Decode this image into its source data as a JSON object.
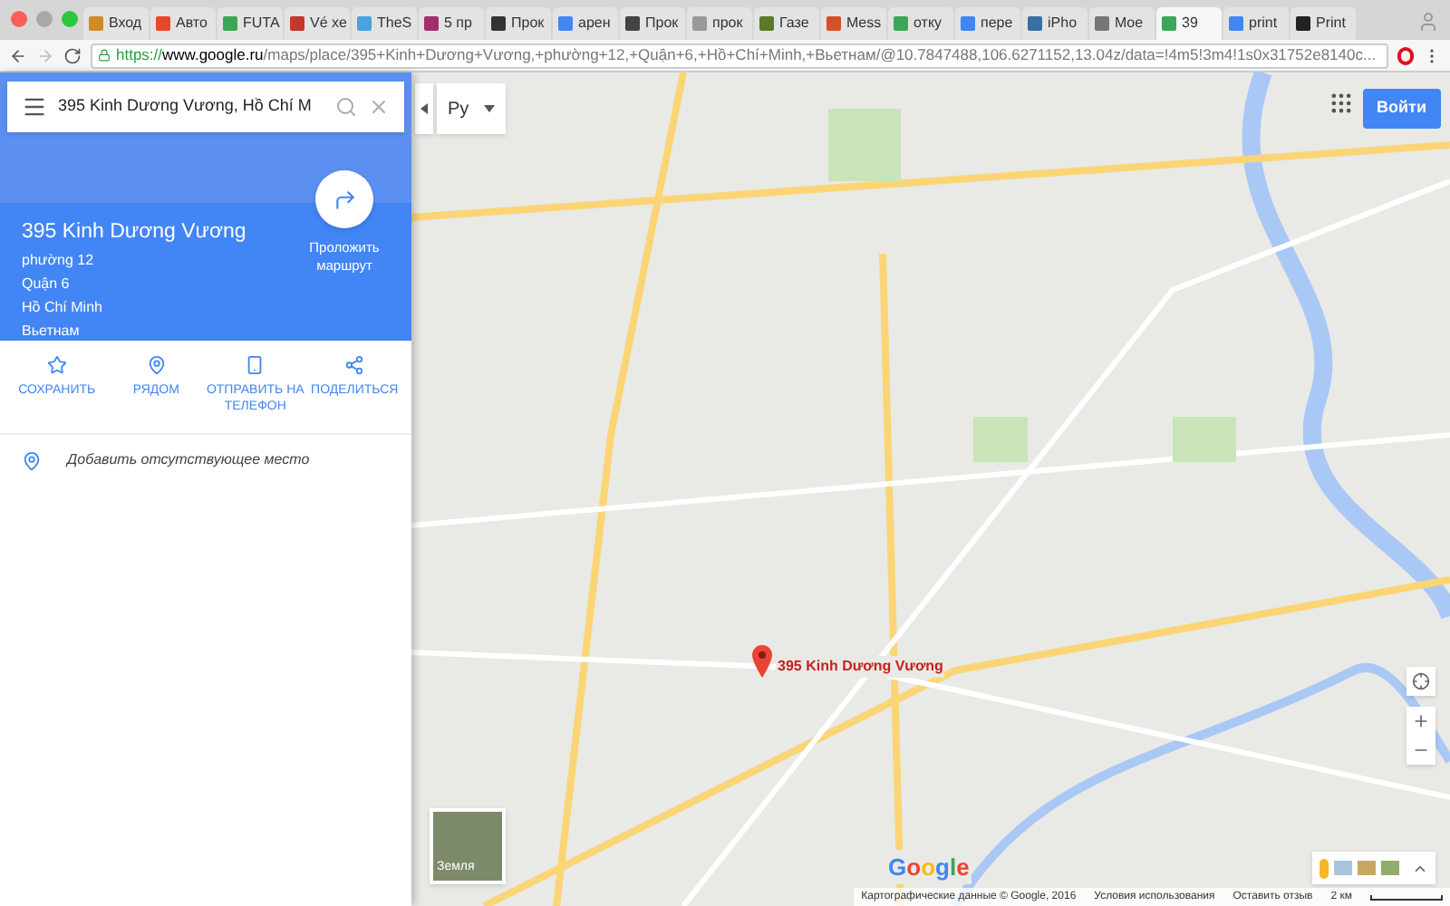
{
  "tabs": [
    {
      "title": "Вход",
      "color": "#d08a2a",
      "selected": false
    },
    {
      "title": "Авто",
      "color": "#e8452c",
      "selected": false
    },
    {
      "title": "FUTA",
      "color": "#3aa757",
      "selected": false
    },
    {
      "title": "Vé xe",
      "color": "#c0392b",
      "selected": false
    },
    {
      "title": "TheS",
      "color": "#4aa3df",
      "selected": false
    },
    {
      "title": "5 пр",
      "color": "#a0306a",
      "selected": false
    },
    {
      "title": "Прок",
      "color": "#333333",
      "selected": false
    },
    {
      "title": "арен",
      "color": "#4285f4",
      "selected": false
    },
    {
      "title": "Прок",
      "color": "#444444",
      "selected": false
    },
    {
      "title": "прок",
      "color": "#999999",
      "selected": false
    },
    {
      "title": "Газе",
      "color": "#5a7a2a",
      "selected": false
    },
    {
      "title": "Mess",
      "color": "#d4502a",
      "selected": false
    },
    {
      "title": "отку",
      "color": "#3aa757",
      "selected": false
    },
    {
      "title": "пере",
      "color": "#4285f4",
      "selected": false
    },
    {
      "title": "iPho",
      "color": "#3a6ea5",
      "selected": false
    },
    {
      "title": "Moe",
      "color": "#777777",
      "selected": false
    },
    {
      "title": "39",
      "color": "#3aa757",
      "selected": true
    },
    {
      "title": "print",
      "color": "#4285f4",
      "selected": false
    },
    {
      "title": "Print",
      "color": "#222222",
      "selected": false
    }
  ],
  "address_bar": {
    "scheme": "https://",
    "host": "www.google.ru",
    "path": "/maps/place/395+Kinh+Dương+Vương,+phường+12,+Quận+6,+Hồ+Chí+Minh,+Вьетнам/@10.7847488,106.6271152,13.04z/data=!4m5!3m4!1s0x31752e8140c..."
  },
  "search": {
    "value": "395 Kinh Dương Vương, Hồ Chí M"
  },
  "language": "Ру",
  "sign_in": "Войти",
  "place": {
    "name": "395 Kinh Dương Vương",
    "address_lines": [
      "phường 12",
      "Quận 6",
      "Hồ Chí Minh",
      "Вьетнам"
    ],
    "directions": "Проложить маршрут"
  },
  "actions": [
    {
      "label": "СОХРАНИТЬ",
      "kind": "star"
    },
    {
      "label": "РЯДОМ",
      "kind": "nearby"
    },
    {
      "label": "ОТПРАВИТЬ НА ТЕЛЕФОН",
      "kind": "phone"
    },
    {
      "label": "ПОДЕЛИТЬСЯ",
      "kind": "share"
    }
  ],
  "add_place": "Добавить отсутствующее место",
  "marker_label": "395 Kinh Dương Vương",
  "earth_label": "Земля",
  "google_logo": "Google",
  "footer": {
    "map_data": "Картографические данные © Google, 2016",
    "terms": "Условия использования",
    "feedback": "Оставить отзыв",
    "scale": "2 км"
  }
}
